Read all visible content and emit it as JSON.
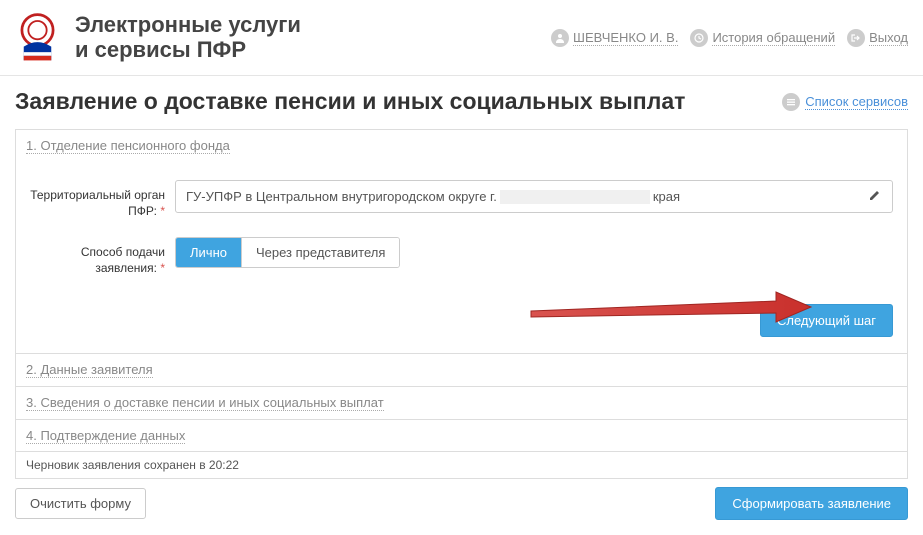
{
  "header": {
    "site_title_line1": "Электронные услуги",
    "site_title_line2": "и сервисы ПФР",
    "user_name": "ШЕВЧЕНКО И. В.",
    "history_label": "История обращений",
    "exit_label": "Выход"
  },
  "page": {
    "title": "Заявление о доставке пенсии и иных социальных выплат",
    "service_list_label": "Список сервисов"
  },
  "steps": {
    "s1": "1. Отделение пенсионного фонда",
    "s2": "2. Данные заявителя",
    "s3": "3. Сведения о доставке пенсии и иных социальных выплат",
    "s4": "4. Подтверждение данных"
  },
  "form": {
    "territory_label": "Территориальный орган ПФР:",
    "territory_value_prefix": "ГУ-УПФР в Центральном внутригородском округе г.",
    "territory_value_suffix": "края",
    "submit_method_label": "Способ подачи заявления:",
    "method_personal": "Лично",
    "method_representative": "Через представителя",
    "next_step_btn": "Следующий шаг"
  },
  "footer": {
    "draft_saved": "Черновик заявления сохранен в 20:22",
    "clear_form": "Очистить форму",
    "submit_form": "Сформировать заявление"
  }
}
